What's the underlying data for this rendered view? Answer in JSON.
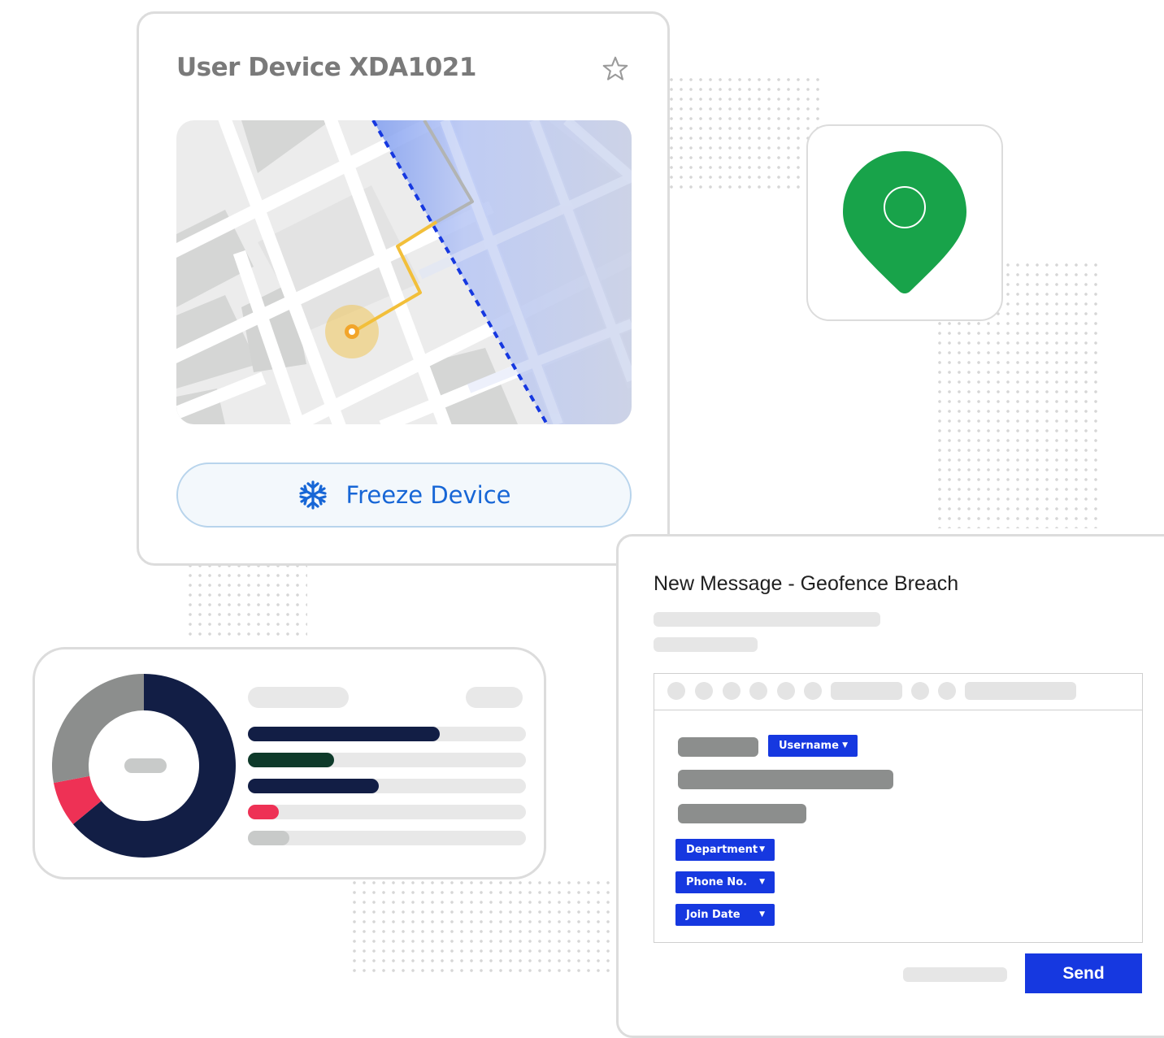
{
  "device_card": {
    "title": "User Device XDA1021",
    "freeze_label": "Freeze Device"
  },
  "message_card": {
    "title": "New Message - Geofence Breach",
    "tags": {
      "username": "Username",
      "department": "Department",
      "phone": "Phone No.",
      "join_date": "Join Date"
    },
    "send_label": "Send"
  },
  "colors": {
    "accent_blue": "#1638e0",
    "pin_green": "#18a34a",
    "route_yellow": "#f2bf3a",
    "navy": "#121e45",
    "dark_green": "#0e3a2a",
    "red": "#ee3155",
    "gray": "#8c8e8d"
  },
  "chart_data": {
    "type": "pie",
    "donut": true,
    "segments": [
      {
        "color": "#121e45",
        "value": 64
      },
      {
        "color": "#ee3155",
        "value": 8
      },
      {
        "color": "#8c8e8d",
        "value": 28
      }
    ],
    "bars": [
      {
        "color": "#121e45",
        "value": 0.69
      },
      {
        "color": "#0e3a2a",
        "value": 0.31
      },
      {
        "color": "#121e45",
        "value": 0.47
      },
      {
        "color": "#ee3155",
        "value": 0.11
      },
      {
        "color": "#c8cac9",
        "value": 0.15
      }
    ]
  }
}
